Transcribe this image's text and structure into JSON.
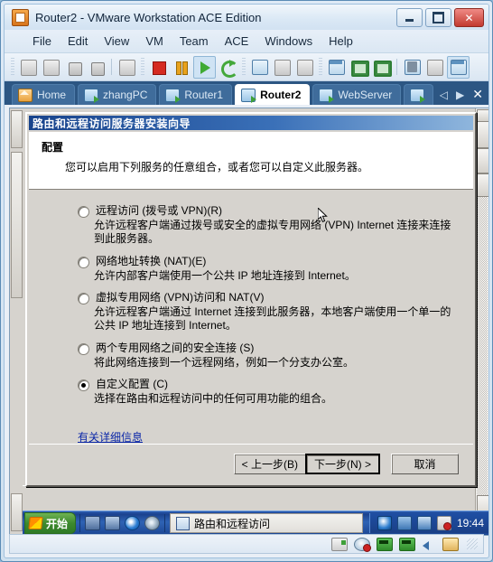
{
  "window": {
    "title": "Router2 - VMware Workstation ACE Edition",
    "icon": "vmware-icon",
    "buttons": {
      "minimize": "minimize-icon",
      "maximize": "maximize-icon",
      "close": "✕"
    }
  },
  "menubar": {
    "items": [
      "File",
      "Edit",
      "View",
      "VM",
      "Team",
      "ACE",
      "Windows",
      "Help"
    ]
  },
  "toolbar": {
    "groups": [
      [
        "power-on-team-icon",
        "power-off-team-icon",
        "add-vm-icon",
        "add-device-icon"
      ],
      [
        "snapshot-manager-icon"
      ],
      [
        "stop-icon",
        "pause-icon",
        "play-icon",
        "reset-icon"
      ],
      [
        "take-snapshot-icon",
        "revert-snapshot-icon",
        "manage-snapshots-icon"
      ],
      [
        "show-sidebar-icon",
        "fullscreen-icon",
        "quick-switch-icon"
      ],
      [
        "settings-icon",
        "summary-icon",
        "console-view-icon"
      ]
    ]
  },
  "tabs": {
    "items": [
      {
        "label": "Home",
        "icon": "home-icon",
        "active": false
      },
      {
        "label": "zhangPC",
        "icon": "vm-icon",
        "active": false
      },
      {
        "label": "Router1",
        "icon": "vm-icon",
        "active": false
      },
      {
        "label": "Router2",
        "icon": "vm-icon",
        "active": true
      },
      {
        "label": "WebServer",
        "icon": "vm-icon",
        "active": false
      },
      {
        "label": "",
        "icon": "vm-icon",
        "active": false
      }
    ],
    "nav": {
      "prev": "◁",
      "next": "▶",
      "close": "✕"
    }
  },
  "dialog": {
    "title": "路由和远程访问服务器安装向导",
    "heading": "配置",
    "subheading": "您可以启用下列服务的任意组合，或者您可以自定义此服务器。",
    "options": [
      {
        "label": "远程访问 (拨号或 VPN)(R)",
        "desc": "允许远程客户端通过拨号或安全的虚拟专用网络 (VPN) Internet 连接来连接到此服务器。",
        "selected": false
      },
      {
        "label": "网络地址转换 (NAT)(E)",
        "desc": "允许内部客户端使用一个公共 IP 地址连接到 Internet。",
        "selected": false
      },
      {
        "label": "虚拟专用网络 (VPN)访问和 NAT(V)",
        "desc": "允许远程客户端通过 Internet 连接到此服务器，本地客户端使用一个单一的公共 IP 地址连接到 Internet。",
        "selected": false
      },
      {
        "label": "两个专用网络之间的安全连接 (S)",
        "desc": "将此网络连接到一个远程网络，例如一个分支办公室。",
        "selected": false
      },
      {
        "label": "自定义配置 (C)",
        "desc": "选择在路由和远程访问中的任何可用功能的组合。",
        "selected": true
      }
    ],
    "more_info_link": "有关详细信息",
    "buttons": {
      "back": "< 上一步(B)",
      "next": "下一步(N) >",
      "cancel": "取消"
    }
  },
  "guest_taskbar": {
    "start_label": "开始",
    "quick_launch": [
      "show-desktop-icon",
      "display-icon",
      "internet-explorer-icon",
      "browser-icon"
    ],
    "task_items": [
      {
        "label": "路由和远程访问",
        "icon": "mmc-icon"
      }
    ],
    "tray_icons": [
      "vmware-tools-icon",
      "network-icon",
      "network-connections-icon",
      "volume-muted-icon"
    ],
    "clock": "19:44"
  },
  "vmware_status": {
    "devices": [
      "floppy-icon",
      "cdrom-icon",
      "network-adapter-1-icon",
      "network-adapter-2-icon",
      "sound-icon",
      "usb-icon"
    ]
  },
  "colors": {
    "dialog_title_start": "#18438c",
    "tab_bar": "#2c5683",
    "link": "#0b27a8",
    "taskbar": "#1b428e",
    "start_button": "#3d8a2e"
  }
}
